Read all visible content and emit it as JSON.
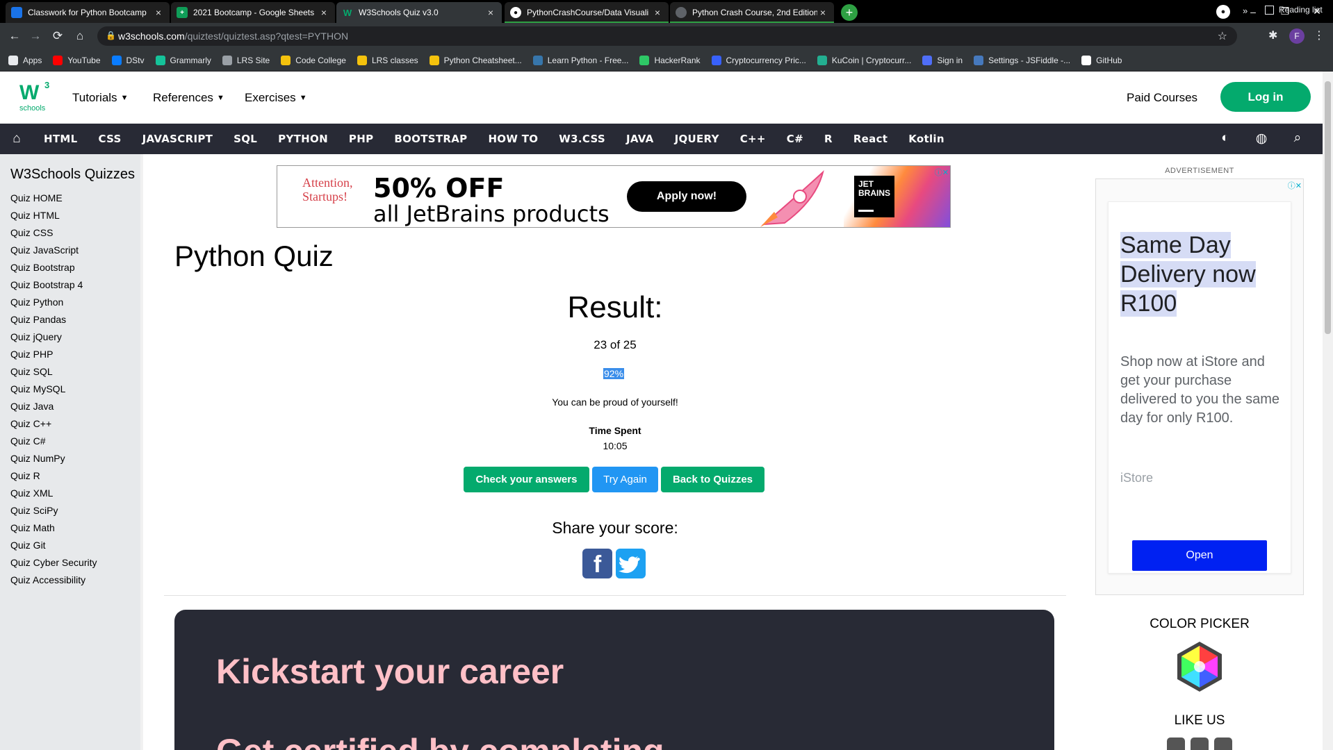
{
  "browser": {
    "tabs": [
      {
        "label": "Classwork for Python Bootcamp",
        "icon": "google-classroom-icon",
        "color": "#1a73e8",
        "active": false
      },
      {
        "label": "2021 Bootcamp - Google Sheets",
        "icon": "google-sheets-icon",
        "color": "#0f9d58",
        "active": false
      },
      {
        "label": "W3Schools Quiz v3.0",
        "icon": "w3schools-icon",
        "color": "#04aa6d",
        "active": true
      },
      {
        "label": "PythonCrashCourse/Data Visuali",
        "icon": "github-icon",
        "color": "#24292e",
        "active": false
      },
      {
        "label": "Python Crash Course, 2nd Edition",
        "icon": "globe-icon",
        "color": "#5f6368",
        "active": false
      }
    ],
    "url_domain": "w3schools.com",
    "url_path": "/quiztest/quiztest.asp?qtest=PYTHON",
    "bookmarks": [
      {
        "label": "Apps",
        "icon": "apps-grid-icon",
        "color": "#e8eaed"
      },
      {
        "label": "YouTube",
        "icon": "youtube-icon",
        "color": "#ff0000"
      },
      {
        "label": "DStv",
        "icon": "dstv-icon",
        "color": "#0a7cff"
      },
      {
        "label": "Grammarly",
        "icon": "grammarly-icon",
        "color": "#15c39a"
      },
      {
        "label": "LRS Site",
        "icon": "lrs-icon",
        "color": "#9aa0a6"
      },
      {
        "label": "Code College",
        "icon": "code-college-icon",
        "color": "#f4c20d"
      },
      {
        "label": "LRS classes",
        "icon": "lrs-classes-icon",
        "color": "#f4c20d"
      },
      {
        "label": "Python Cheatsheet...",
        "icon": "python-cheatsheet-icon",
        "color": "#f4c20d"
      },
      {
        "label": "Learn Python - Free...",
        "icon": "python-icon",
        "color": "#3776ab"
      },
      {
        "label": "HackerRank",
        "icon": "hackerrank-icon",
        "color": "#2ec866"
      },
      {
        "label": "Cryptocurrency Pric...",
        "icon": "coinmarketcap-icon",
        "color": "#3861fb"
      },
      {
        "label": "KuCoin | Cryptocurr...",
        "icon": "kucoin-icon",
        "color": "#23af91"
      },
      {
        "label": "Sign in",
        "icon": "vue-icon",
        "color": "#4f6ef7"
      },
      {
        "label": "Settings - JSFiddle -...",
        "icon": "jsfiddle-icon",
        "color": "#4679bd"
      },
      {
        "label": "GitHub",
        "icon": "github-icon",
        "color": "#ffffff"
      }
    ],
    "reading_list": "Reading list",
    "profile_initial": "F"
  },
  "header": {
    "logo_w3": "W",
    "logo_sup": "3",
    "logo_schools": "schools",
    "nav": [
      "Tutorials",
      "References",
      "Exercises"
    ],
    "paid_courses": "Paid Courses",
    "login": "Log in"
  },
  "darknav": {
    "items": [
      "HTML",
      "CSS",
      "JAVASCRIPT",
      "SQL",
      "PYTHON",
      "PHP",
      "BOOTSTRAP",
      "HOW TO",
      "W3.CSS",
      "JAVA",
      "JQUERY",
      "C++",
      "C#",
      "R",
      "React",
      "Kotlin"
    ]
  },
  "sidebar": {
    "title": "W3Schools Quizzes",
    "items": [
      "Quiz HOME",
      "Quiz HTML",
      "Quiz CSS",
      "Quiz JavaScript",
      "Quiz Bootstrap",
      "Quiz Bootstrap 4",
      "Quiz Python",
      "Quiz Pandas",
      "Quiz jQuery",
      "Quiz PHP",
      "Quiz SQL",
      "Quiz MySQL",
      "Quiz Java",
      "Quiz C++",
      "Quiz C#",
      "Quiz NumPy",
      "Quiz R",
      "Quiz XML",
      "Quiz SciPy",
      "Quiz Math",
      "Quiz Git",
      "Quiz Cyber Security",
      "Quiz Accessibility"
    ]
  },
  "ad_banner": {
    "attention": "Attention,",
    "startups": "Startups!",
    "offer": "50% OFF",
    "products": "all JetBrains products",
    "cta": "Apply now!",
    "brand_line1": "JET",
    "brand_line2": "BRAINS"
  },
  "main": {
    "title": "Python Quiz",
    "result_heading": "Result:",
    "score_text": "23 of 25",
    "percent": "92%",
    "message": "You can be proud of yourself!",
    "time_label": "Time Spent",
    "time_value": "10:05",
    "buttons": {
      "check": "Check your answers",
      "try": "Try Again",
      "back": "Back to Quizzes"
    },
    "share": "Share your score:",
    "kickstart_title": "Kickstart your career",
    "kickstart_sub": "Get certified by completing"
  },
  "right": {
    "advertisement": "ADVERTISEMENT",
    "istore_headline": [
      "Same Day",
      "Delivery now",
      "R100"
    ],
    "istore_body": "Shop now at iStore and get your purchase delivered to you the same day for only R100.",
    "istore_brand": "iStore",
    "istore_cta": "Open",
    "color_picker": "COLOR PICKER",
    "like_us": "LIKE US"
  },
  "colors": {
    "w3_green": "#04aa6d",
    "darknav": "#282a35",
    "try_blue": "#2196f3",
    "istore_blue": "#0021f2",
    "kickstart_pink": "#ffc0c7"
  }
}
